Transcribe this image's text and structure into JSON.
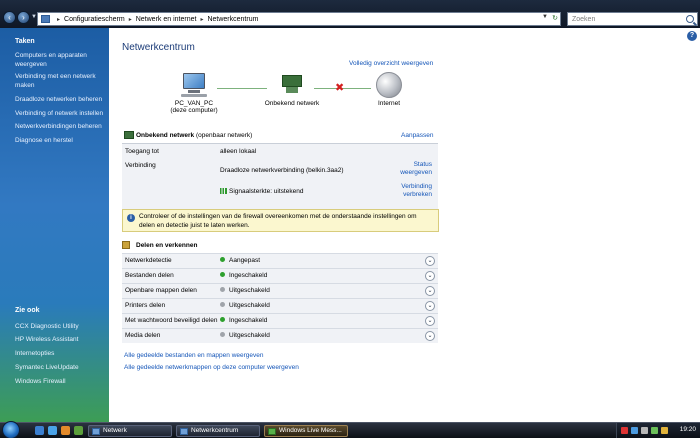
{
  "window": {
    "breadcrumb": [
      "Configuratiescherm",
      "Netwerk en internet",
      "Netwerkcentrum"
    ],
    "search_placeholder": "Zoeken"
  },
  "sidebar": {
    "tasks_heading": "Taken",
    "tasks": [
      "Computers en apparaten weergeven",
      "Verbinding met een netwerk maken",
      "Draadloze netwerken beheren",
      "Verbinding of netwerk instellen",
      "Netwerkverbindingen beheren",
      "Diagnose en herstel"
    ],
    "see_also_heading": "Zie ook",
    "see_also": [
      "CCX Diagnostic Utility",
      "HP Wireless Assistant",
      "Internetopties",
      "Symantec LiveUpdate",
      "Windows Firewall"
    ]
  },
  "main": {
    "title": "Netwerkcentrum",
    "full_map_link": "Volledig overzicht weergeven",
    "map": {
      "computer_name": "PC_VAN_PC",
      "computer_sub": "(deze computer)",
      "network_name": "Onbekend netwerk",
      "internet_name": "Internet"
    },
    "network": {
      "name": "Onbekend netwerk",
      "type": "(openbaar netwerk)",
      "customize_link": "Aanpassen",
      "rows": {
        "access_label": "Toegang tot",
        "access_value": "alleen lokaal",
        "connection_label": "Verbinding",
        "connection_value": "Draadloze netwerkverbinding (belkin.3aa2)",
        "signal_value": "Signaalsterkte: uitstekend",
        "status_link": "Status weergeven",
        "disconnect_link": "Verbinding verbreken"
      }
    },
    "notice": "Controleer of de instellingen van de firewall overeenkomen met de onderstaande instellingen om delen en detectie juist te laten werken.",
    "sharing": {
      "heading": "Delen en verkennen",
      "rows": [
        {
          "label": "Netwerkdetectie",
          "status": "Aangepast",
          "on": true
        },
        {
          "label": "Bestanden delen",
          "status": "Ingeschakeld",
          "on": true
        },
        {
          "label": "Openbare mappen delen",
          "status": "Uitgeschakeld",
          "on": false
        },
        {
          "label": "Printers delen",
          "status": "Uitgeschakeld",
          "on": false
        },
        {
          "label": "Met wachtwoord beveiligd delen",
          "status": "Ingeschakeld",
          "on": true
        },
        {
          "label": "Media delen",
          "status": "Uitgeschakeld",
          "on": false
        }
      ]
    },
    "links": [
      "Alle gedeelde bestanden en mappen weergeven",
      "Alle gedeelde netwerkmappen op deze computer weergeven"
    ]
  },
  "taskbar": {
    "buttons": [
      "Netwerk",
      "Netwerkcentrum",
      "Windows Live Mess..."
    ],
    "clock": "19:20"
  },
  "colors": {
    "link": "#1556b8",
    "status_on": "#2ea02e",
    "status_off": "#a0a4aa"
  }
}
